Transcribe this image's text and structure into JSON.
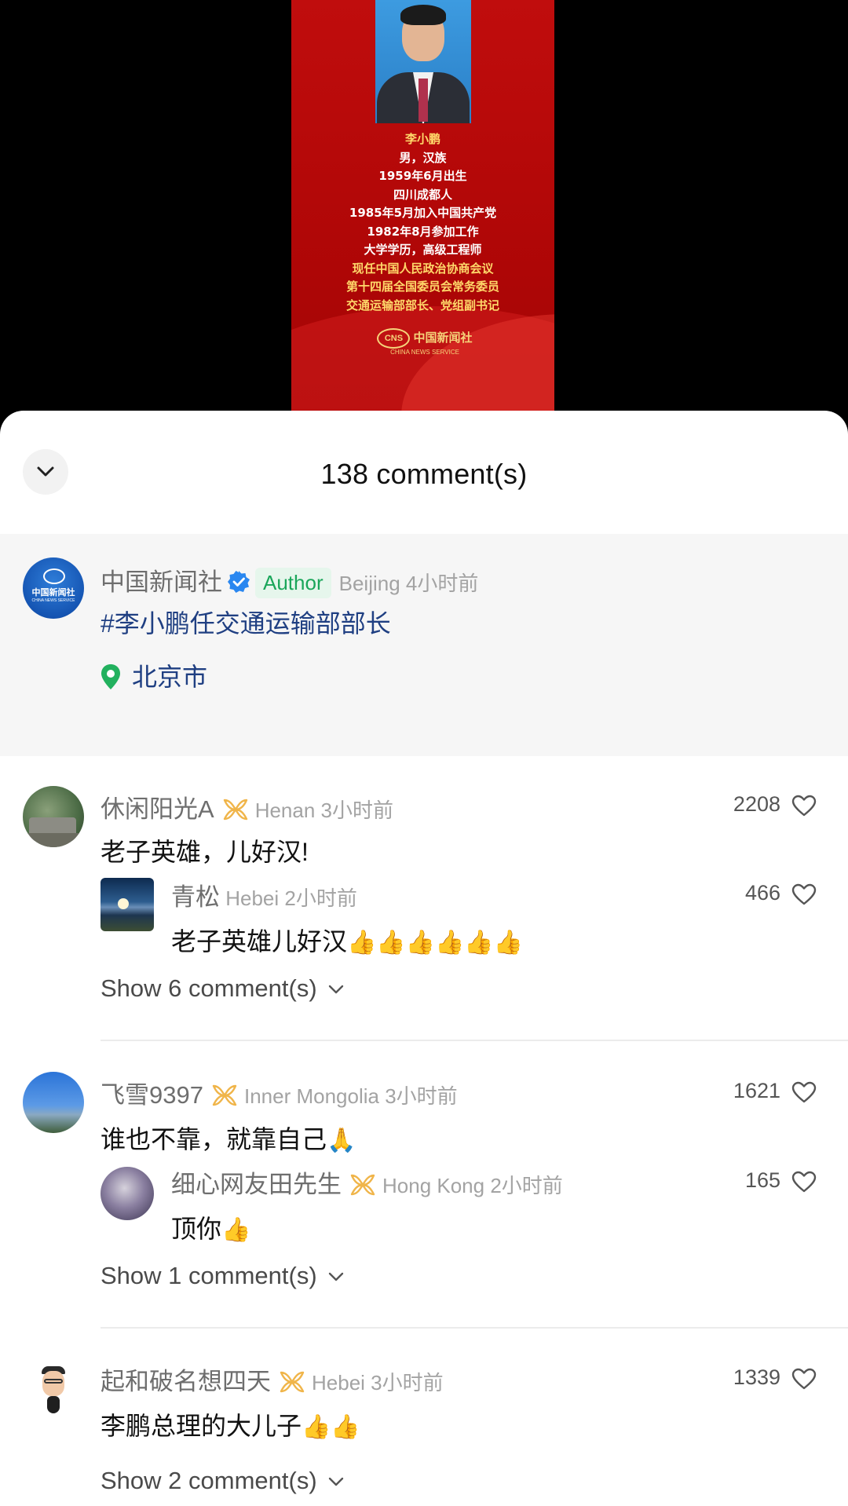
{
  "video": {
    "poster_lines": [
      "李小鹏",
      "男，汉族",
      "1959年6月出生",
      "四川成都人",
      "1985年5月加入中国共产党",
      "1982年8月参加工作",
      "大学学历，高级工程师",
      "现任中国人民政治协商会议",
      "第十四届全国委员会常务委员",
      "交通运输部部长、党组副书记"
    ],
    "logo_mark": "CNS",
    "logo_cn": "中国新闻社",
    "logo_en": "CHINA NEWS SERVICE"
  },
  "sheet": {
    "title": "138 comment(s)",
    "collapse_icon": "chevron-down-icon"
  },
  "author_comment": {
    "avatar_text": "中国新闻社",
    "avatar_sub": "CHINA NEWS SERVICE",
    "username": "中国新闻社",
    "badge": "Author",
    "region": "Beijing",
    "time": "4小时前",
    "hashtag": "#李小鹏任交通运输部部长",
    "location": "北京市"
  },
  "comments": [
    {
      "username": "休闲阳光A",
      "region": "Henan",
      "time": "3小时前",
      "text": "老子英雄，儿好汉!",
      "likes": "2208",
      "reply": {
        "username": "青松",
        "region": "Hebei",
        "time": "2小时前",
        "text": "老子英雄儿好汉",
        "emoji": "👍👍👍👍👍👍",
        "likes": "466"
      },
      "show_more": "Show 6 comment(s)"
    },
    {
      "username": "飞雪9397",
      "region": "Inner Mongolia",
      "time": "3小时前",
      "text": "谁也不靠，就靠自己",
      "emoji": "🙏",
      "likes": "1621",
      "reply": {
        "username": "细心网友田先生",
        "region": "Hong Kong",
        "time": "2小时前",
        "text": "顶你",
        "emoji": "👍",
        "likes": "165"
      },
      "show_more": "Show 1 comment(s)"
    },
    {
      "username": "起和破名想四天",
      "region": "Hebei",
      "time": "3小时前",
      "text": "李鹏总理的大儿子",
      "emoji": "👍👍",
      "likes": "1339",
      "show_more": "Show 2 comment(s)"
    }
  ],
  "colors": {
    "accent_link": "#1f3f82",
    "author_tag_bg": "#e6f6ec",
    "author_tag_fg": "#1aa65a",
    "level_icon": "#f0b54a",
    "poster_red": "#b10707"
  }
}
